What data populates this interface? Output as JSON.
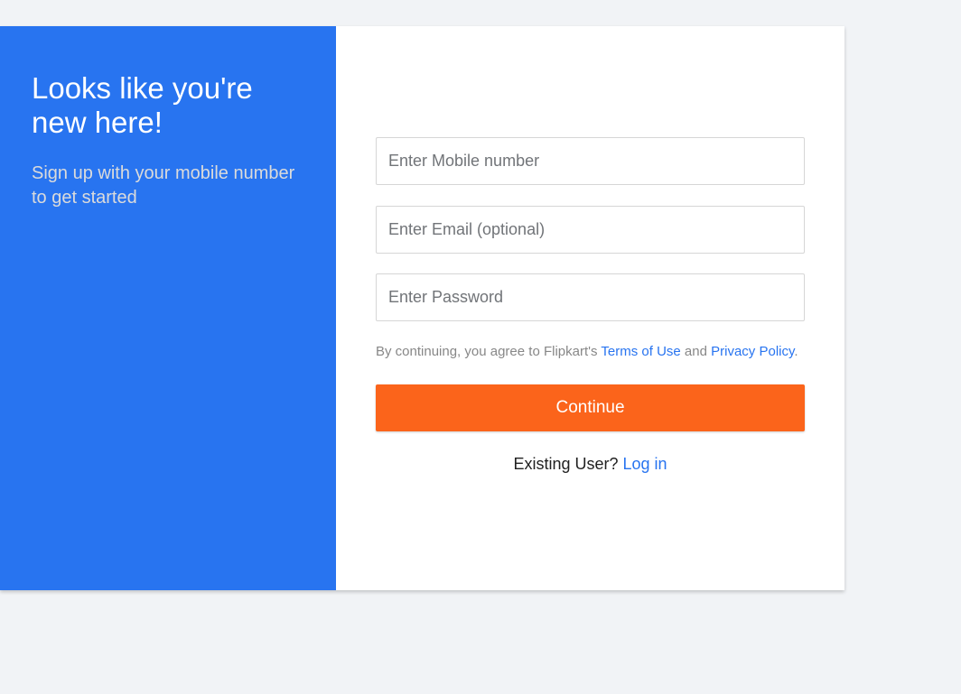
{
  "left_panel": {
    "title": "Looks like you're new here!",
    "subtitle": "Sign up with your mobile number to get started"
  },
  "form": {
    "mobile_placeholder": "Enter Mobile number",
    "email_placeholder": "Enter Email (optional)",
    "password_placeholder": "Enter Password",
    "terms_prefix": "By continuing, you agree to Flipkart's ",
    "terms_link": "Terms of Use",
    "terms_and": " and ",
    "privacy_link": "Privacy Policy",
    "terms_suffix": ".",
    "continue_label": "Continue",
    "existing_prefix": "Existing User? ",
    "login_link": "Log in"
  },
  "colors": {
    "brand_blue": "#2874f0",
    "action_orange": "#fb641b",
    "page_background": "#f1f3f6"
  }
}
